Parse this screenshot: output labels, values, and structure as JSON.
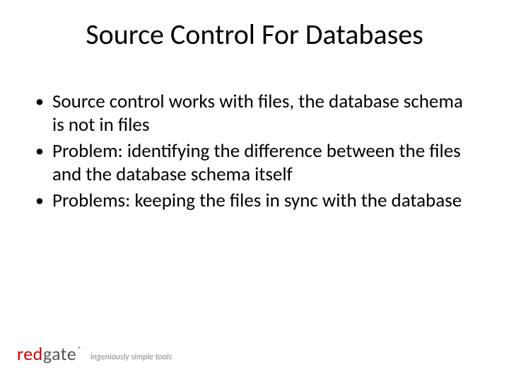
{
  "title": "Source Control For Databases",
  "bullets": [
    "Source control works with files, the database schema is not in files",
    "Problem: identifying the difference between the files and the database schema itself",
    "Problems: keeping the files in sync with the database"
  ],
  "logo": {
    "part1": "red",
    "part2": "gate",
    "registered": "®"
  },
  "tagline": "ingeniously simple tools"
}
